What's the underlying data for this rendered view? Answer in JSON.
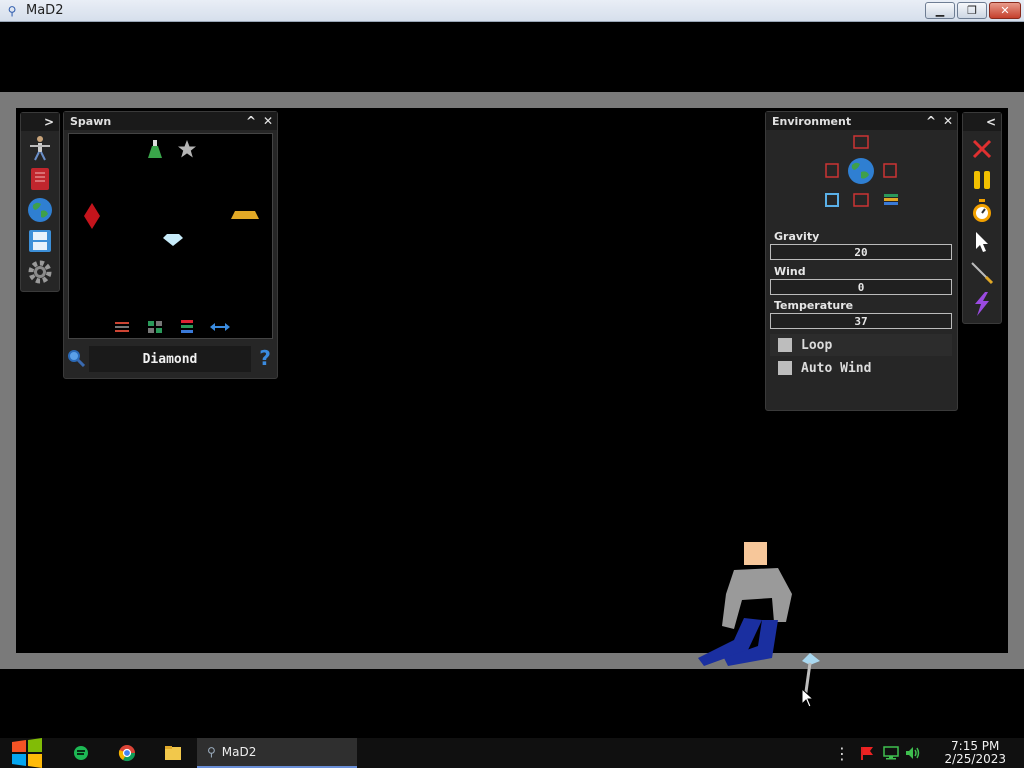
{
  "window": {
    "title": "MaD2",
    "minimize_label": "▁",
    "restore_label": "❐",
    "close_label": "✕"
  },
  "left_toolstrip": {
    "expand_label": ">",
    "icons": [
      "character-icon",
      "book-icon",
      "globe-icon",
      "save-icon",
      "settings-icon"
    ]
  },
  "spawn_panel": {
    "title": "Spawn",
    "collapse_label": "^",
    "close_label": "✕",
    "search_value": "Diamond",
    "help_label": "?",
    "items": [
      "flask-icon",
      "star-icon",
      "red-diamond-icon",
      "gold-bar-icon",
      "diamond-icon"
    ],
    "bottom_tools": [
      "sliders-icon",
      "grid-icon",
      "list-icon",
      "swap-icon"
    ]
  },
  "environment_panel": {
    "title": "Environment",
    "collapse_label": "^",
    "close_label": "✕",
    "gravity": {
      "label": "Gravity",
      "value": "20"
    },
    "wind": {
      "label": "Wind",
      "value": "0"
    },
    "temperature": {
      "label": "Temperature",
      "value": "37"
    },
    "loop": {
      "label": "Loop",
      "checked": false
    },
    "auto_wind": {
      "label": "Auto Wind",
      "checked": false
    }
  },
  "right_toolstrip": {
    "collapse_label": "<",
    "icons": [
      "close-x-icon",
      "pause-icon",
      "timer-icon",
      "pointer-icon",
      "syringe-icon",
      "lightning-icon"
    ]
  },
  "taskbar": {
    "app_label": "MaD2",
    "time": "7:15 PM",
    "date": "2/25/2023"
  },
  "colors": {
    "background": "#000000",
    "frame": "#7a7a7a",
    "panel": "#262626",
    "accent_red": "#e03030",
    "accent_yellow": "#f2c000"
  }
}
